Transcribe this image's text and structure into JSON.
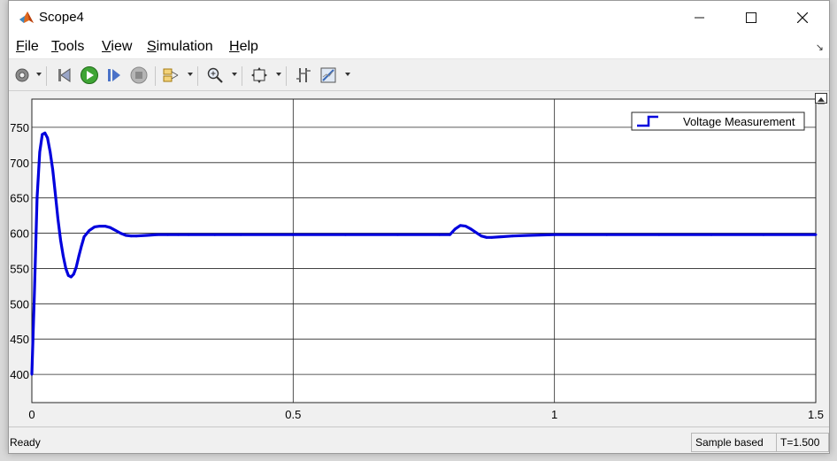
{
  "window": {
    "title": "Scope4"
  },
  "menu": {
    "items": [
      {
        "label": "File",
        "u": "F",
        "rest": "ile"
      },
      {
        "label": "Tools",
        "u": "T",
        "rest": "ools"
      },
      {
        "label": "View",
        "u": "V",
        "rest": "iew"
      },
      {
        "label": "Simulation",
        "u": "S",
        "rest": "imulation"
      },
      {
        "label": "Help",
        "u": "H",
        "rest": "elp"
      }
    ]
  },
  "toolbar": {
    "icons": [
      "settings-icon",
      "step-back-icon",
      "run-icon",
      "step-forward-icon",
      "stop-icon",
      "signal-selector-icon",
      "zoom-icon",
      "autoscale-icon",
      "cursor-measurements-icon",
      "style-icon"
    ]
  },
  "colors": {
    "trace": "#0000dd",
    "grid": "#262626",
    "plot_bg": "#ffffff"
  },
  "chart_data": {
    "type": "line",
    "title": "",
    "xlabel": "",
    "ylabel": "",
    "xlim": [
      0,
      1.5
    ],
    "ylim": [
      360,
      790
    ],
    "x_ticks": [
      "0",
      "0.5",
      "1",
      "1.5"
    ],
    "y_ticks": [
      "400",
      "450",
      "500",
      "550",
      "600",
      "650",
      "700",
      "750"
    ],
    "grid": true,
    "legend": {
      "position": "top-right",
      "entries": [
        "Voltage Measurement"
      ]
    },
    "series": [
      {
        "name": "Voltage Measurement",
        "color": "#0000dd",
        "x": [
          0,
          0.005,
          0.01,
          0.015,
          0.02,
          0.025,
          0.03,
          0.035,
          0.04,
          0.045,
          0.05,
          0.055,
          0.06,
          0.065,
          0.07,
          0.075,
          0.08,
          0.085,
          0.09,
          0.095,
          0.1,
          0.11,
          0.12,
          0.13,
          0.14,
          0.15,
          0.16,
          0.17,
          0.18,
          0.19,
          0.2,
          0.22,
          0.24,
          0.26,
          0.28,
          0.3,
          0.35,
          0.4,
          0.5,
          0.6,
          0.7,
          0.78,
          0.8,
          0.81,
          0.82,
          0.83,
          0.84,
          0.85,
          0.86,
          0.87,
          0.88,
          0.9,
          0.92,
          0.95,
          1.0,
          1.1,
          1.2,
          1.3,
          1.4,
          1.5
        ],
        "y": [
          400,
          520,
          650,
          715,
          740,
          742,
          735,
          715,
          690,
          655,
          620,
          590,
          568,
          550,
          540,
          538,
          542,
          552,
          568,
          582,
          595,
          604,
          609,
          610,
          610,
          608,
          604,
          600,
          597,
          596,
          596,
          597,
          598,
          598,
          598,
          598,
          598,
          598,
          598,
          598,
          598,
          598,
          598,
          606,
          611,
          610,
          606,
          601,
          596,
          594,
          594,
          595,
          596,
          597,
          598,
          598,
          598,
          598,
          598,
          598
        ]
      }
    ]
  },
  "status": {
    "ready": "Ready",
    "sample": "Sample based",
    "time": "T=1.500"
  }
}
